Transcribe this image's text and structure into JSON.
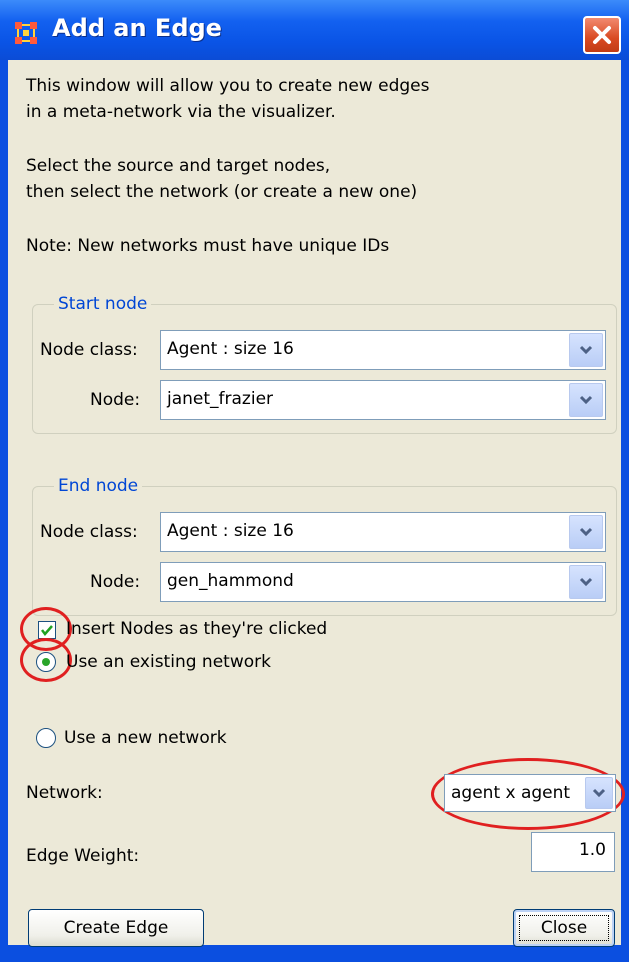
{
  "window": {
    "title": "Add an Edge"
  },
  "intro": {
    "line1": "This window will allow you to create new edges",
    "line2": "in a meta-network via the visualizer.",
    "line3": "Select the source and target nodes,",
    "line4": "then select the network (or create a new one)",
    "note": "Note: New networks must have unique IDs"
  },
  "start_node": {
    "legend": "Start node",
    "node_class_label": "Node class:",
    "node_class_value": "Agent : size 16",
    "node_label": "Node:",
    "node_value": "janet_frazier"
  },
  "end_node": {
    "legend": "End node",
    "node_class_label": "Node class:",
    "node_class_value": "Agent : size 16",
    "node_label": "Node:",
    "node_value": "gen_hammond"
  },
  "insert_nodes": {
    "label": "Insert Nodes as they're clicked",
    "checked": true
  },
  "network_mode": {
    "existing_label": "Use an existing network",
    "new_label": "Use a new network",
    "selected": "existing"
  },
  "network": {
    "label": "Network:",
    "value": "agent x agent"
  },
  "edge_weight": {
    "label": "Edge Weight:",
    "value": "1.0"
  },
  "buttons": {
    "create": "Create Edge",
    "close": "Close"
  },
  "colors": {
    "titlebar": "#0b54e6",
    "client": "#ece9d8",
    "legend": "#0046d5",
    "highlight": "#e02020"
  },
  "icons": {
    "app": "network-grid-icon",
    "close": "close-icon",
    "dropdown": "chevron-down-icon"
  }
}
